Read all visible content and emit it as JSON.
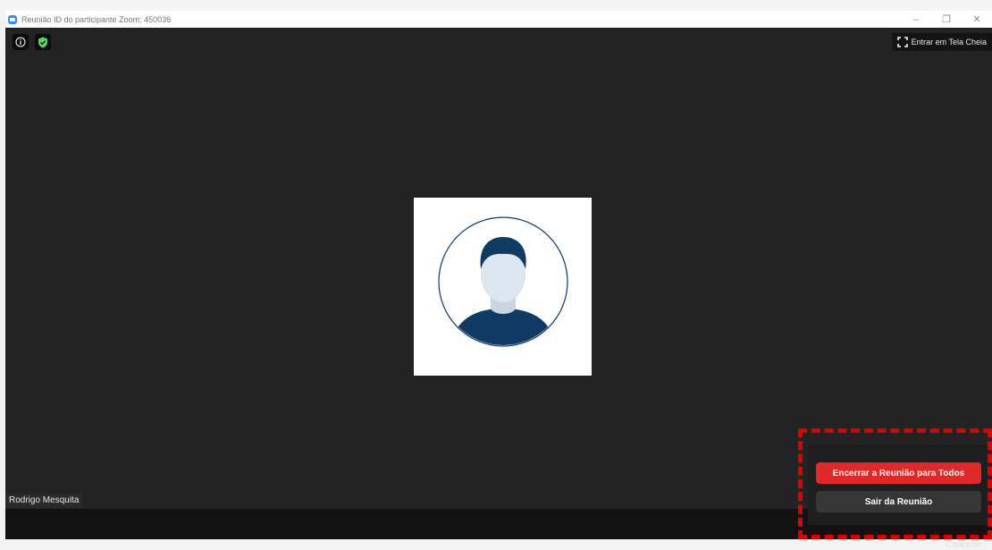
{
  "window": {
    "title": "Reunião ID do participante Zoom: 450036",
    "controls": [
      "–",
      "❐",
      "✕"
    ]
  },
  "top_icons": [
    {
      "name": "info-icon",
      "color": "#ffffff"
    },
    {
      "name": "shield-icon",
      "color": "#4ed964"
    }
  ],
  "fullscreen": {
    "label": "Entrar em Tela Cheia",
    "icon": "fullscreen-icon"
  },
  "participant": {
    "name": "Rodrigo Mesquita"
  },
  "end_menu": {
    "end_all_label": "Encerrar a Reunião para Todos",
    "leave_label": "Sair da Reunião",
    "cancel_label": "Cancelar"
  },
  "colors": {
    "end_button": "#e02828",
    "highlight": "#e00000",
    "avatar_dark": "#0e3a63",
    "avatar_skin": "#dbe6ee"
  }
}
